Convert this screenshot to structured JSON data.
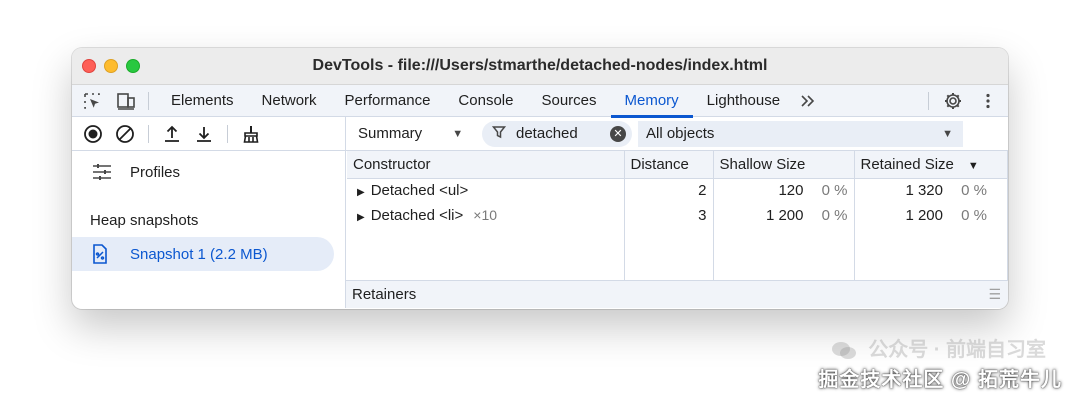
{
  "window": {
    "title": "DevTools - file:///Users/stmarthe/detached-nodes/index.html"
  },
  "tabs": [
    {
      "label": "Elements",
      "active": false
    },
    {
      "label": "Network",
      "active": false
    },
    {
      "label": "Performance",
      "active": false
    },
    {
      "label": "Console",
      "active": false
    },
    {
      "label": "Sources",
      "active": false
    },
    {
      "label": "Memory",
      "active": true
    },
    {
      "label": "Lighthouse",
      "active": false
    }
  ],
  "tabbar_icons": [
    "inspect-element-icon",
    "device-toolbar-icon",
    "more-tabs-icon",
    "settings-gear-icon",
    "kebab-menu-icon"
  ],
  "toolbar": {
    "view_select": "Summary",
    "filter_value": "detached",
    "objects_select": "All objects"
  },
  "sidebar": {
    "profiles_label": "Profiles",
    "heading": "Heap snapshots",
    "snapshot_label": "Snapshot 1 (2.2 MB)"
  },
  "table": {
    "columns": [
      "Constructor",
      "Distance",
      "Shallow Size",
      "Retained Size"
    ],
    "rows": [
      {
        "name": "Detached <ul>",
        "multiplier": "",
        "distance": "2",
        "shallow": "120",
        "shallow_pct": "0 %",
        "retained": "1 320",
        "retained_pct": "0 %"
      },
      {
        "name": "Detached <li>",
        "multiplier": "×10",
        "distance": "3",
        "shallow": "1 200",
        "shallow_pct": "0 %",
        "retained": "1 200",
        "retained_pct": "0 %"
      }
    ]
  },
  "retainers_label": "Retainers",
  "watermark": {
    "faint": "公众号 · 前端自习室",
    "main": "掘金技术社区 @ 拓荒牛儿"
  },
  "colors": {
    "accent": "#0b57d0",
    "toolbar_bg": "#f1f4f9",
    "selected_bg": "#e5ecf8"
  }
}
